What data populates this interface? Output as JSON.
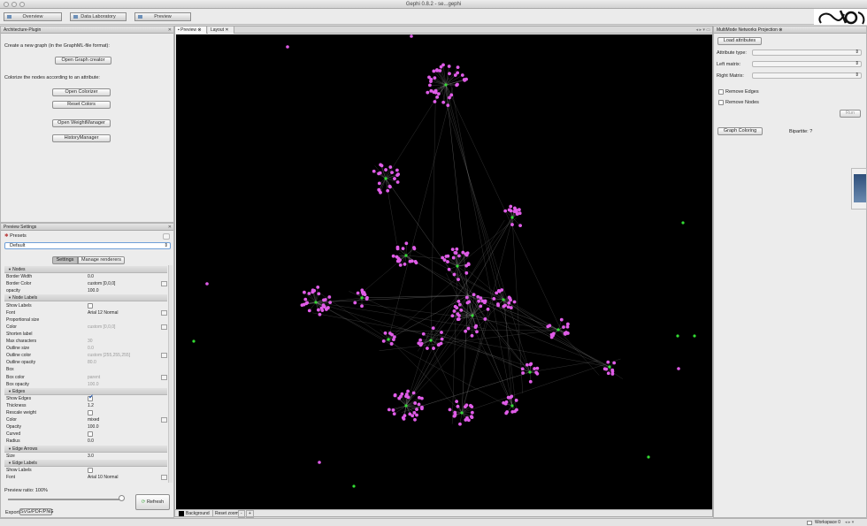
{
  "window": {
    "title": "Gephi 0.8.2 - se...gephi"
  },
  "toolbar": {
    "overview": "Overview",
    "data_lab": "Data Laboratory",
    "preview": "Preview"
  },
  "arch_panel": {
    "tab": "Architecture-Plugin",
    "create_text": "Create a new graph (in the GraphML-file format):",
    "open_graph_creator": "Open Graph creator",
    "colorize_text": "Colorize the nodes according to an attribute:",
    "open_colorizer": "Open Colorizer",
    "reset_colors": "Reset Colors",
    "open_weight_manager": "Open WeightManager",
    "history_manager": "HistoryManager"
  },
  "preview_settings": {
    "tab": "Preview Settings",
    "presets_label": "Presets",
    "preset_value": "Default",
    "settings_tab": "Settings",
    "manage_renderers_tab": "Manage renderers",
    "rows": [
      {
        "type": "section",
        "label": "Nodes"
      },
      {
        "type": "value",
        "label": "Border Width",
        "value": "0.0"
      },
      {
        "type": "value",
        "label": "Border Color",
        "value": "custom [0,0,0]",
        "dd": true
      },
      {
        "type": "value",
        "label": "opacity",
        "value": "100.0"
      },
      {
        "type": "section",
        "label": "Node Labels"
      },
      {
        "type": "check",
        "label": "Show Labels",
        "checked": false
      },
      {
        "type": "value",
        "label": "Font",
        "value": "Arial 12 Normal",
        "dd": true
      },
      {
        "type": "check",
        "label": "Proportional size",
        "checked": true,
        "hidden": true
      },
      {
        "type": "value",
        "label": "Color",
        "value": "custom [0,0,0]",
        "dim": true,
        "dd": true
      },
      {
        "type": "check",
        "label": "Shorten label",
        "checked": false,
        "hidden": true
      },
      {
        "type": "value",
        "label": "Max characters",
        "value": "30",
        "dim": true
      },
      {
        "type": "value",
        "label": "Outline size",
        "value": "0.0",
        "dim": true
      },
      {
        "type": "value",
        "label": "Outline color",
        "value": "custom [255,255,255]",
        "dim": true,
        "dd": true
      },
      {
        "type": "value",
        "label": "Outline opacity",
        "value": "80.0",
        "dim": true
      },
      {
        "type": "check",
        "label": "Box",
        "checked": false,
        "hidden": true
      },
      {
        "type": "value",
        "label": "Box color",
        "value": "parent",
        "dim": true,
        "dd": true
      },
      {
        "type": "value",
        "label": "Box opacity",
        "value": "100.0",
        "dim": true
      },
      {
        "type": "section",
        "label": "Edges"
      },
      {
        "type": "check",
        "label": "Show Edges",
        "checked": true
      },
      {
        "type": "value",
        "label": "Thickness",
        "value": "1.2"
      },
      {
        "type": "check",
        "label": "Rescale weight",
        "checked": false
      },
      {
        "type": "value",
        "label": "Color",
        "value": "mixed",
        "dd": true
      },
      {
        "type": "value",
        "label": "Opacity",
        "value": "100.0"
      },
      {
        "type": "check",
        "label": "Curved",
        "checked": false
      },
      {
        "type": "value",
        "label": "Radius",
        "value": "0.0"
      },
      {
        "type": "section",
        "label": "Edge Arrows"
      },
      {
        "type": "value",
        "label": "Size",
        "value": "3.0"
      },
      {
        "type": "section",
        "label": "Edge Labels"
      },
      {
        "type": "check",
        "label": "Show Labels",
        "checked": false
      },
      {
        "type": "value",
        "label": "Font",
        "value": "Arial 10 Normal",
        "dd": true
      }
    ],
    "preview_ratio": "Preview ratio: 100%",
    "refresh": "Refresh",
    "export_label": "Export",
    "export_button": "SVG/PDF/PNG"
  },
  "canvas": {
    "tab_preview": "Preview",
    "tab_layout": "Layout",
    "background_label": "Background",
    "reset_zoom": "Reset zoom",
    "minus": "-",
    "plus": "+"
  },
  "multimode": {
    "tab": "MultiMode Networks Projection",
    "load_attributes": "Load attributes",
    "attribute_type": "Attribute type:",
    "left_matrix": "Left matrix:",
    "right_matrix": "Right Matrix:",
    "remove_edges": "Remove Edges",
    "remove_nodes": "Remove Nodes",
    "run": "Run",
    "graph_coloring": "Graph Coloring",
    "bipartite": "Bipartite: ?"
  },
  "status": {
    "workspace": "Workspace 0"
  },
  "colors": {
    "node": "#e05ce8",
    "hub": "#33dd33",
    "edge": "#8a8a8a",
    "background": "#000000"
  }
}
